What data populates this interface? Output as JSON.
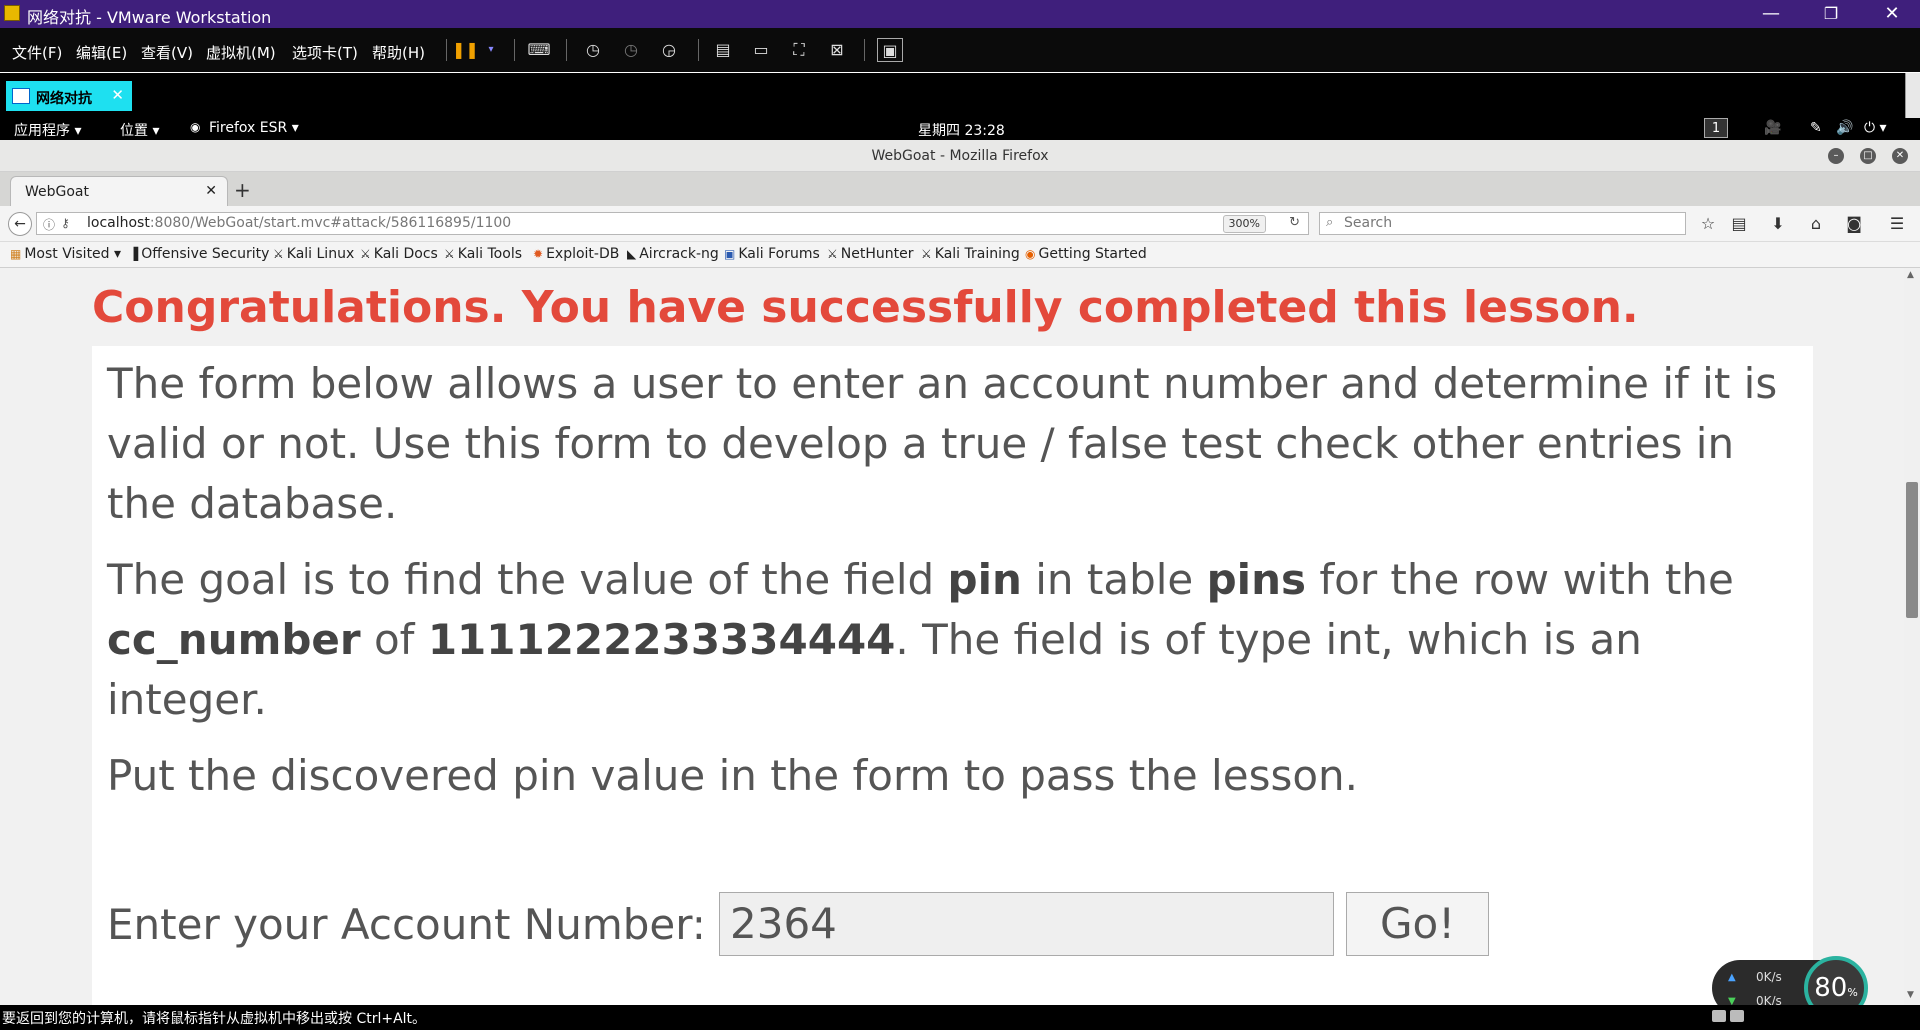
{
  "vmware": {
    "title": "网络对抗 - VMware Workstation",
    "window_controls": [
      "—",
      "❐",
      "✕"
    ],
    "menu": [
      "文件(F)",
      "编辑(E)",
      "查看(V)",
      "虚拟机(M)",
      "选项卡(T)",
      "帮助(H)"
    ],
    "toolbar_icons": [
      "pause-icon",
      "dropdown-icon",
      "send-keys-icon",
      "snapshot-take-icon",
      "snapshot-revert-icon",
      "snapshot-manager-icon",
      "view-sidebar-icon",
      "view-console-icon",
      "fullscreen-icon",
      "unity-icon",
      "thumbnail-view-icon"
    ],
    "tab_label": "网络对抗",
    "tab_close": "✕",
    "status_message": "要返回到您的计算机，请将鼠标指针从虚拟机中移出或按 Ctrl+Alt。"
  },
  "kali_panel": {
    "apps": "应用程序 ▾",
    "places": "位置 ▾",
    "browser": "Firefox ESR ▾",
    "clock": "星期四 23:28",
    "workspace": "1"
  },
  "firefox": {
    "window_title": "WebGoat - Mozilla Firefox",
    "tab_title": "WebGoat",
    "url_host": "localhost",
    "url_rest": ":8080/WebGoat/start.mvc#attack/586116895/1100",
    "zoom": "300%",
    "search_placeholder": "Search",
    "bookmarks": [
      {
        "label": "Most Visited",
        "icon": "folder-icon"
      },
      {
        "label": "Offensive Security",
        "icon": "offsec-icon"
      },
      {
        "label": "Kali Linux",
        "icon": "kali-icon"
      },
      {
        "label": "Kali Docs",
        "icon": "kali-icon"
      },
      {
        "label": "Kali Tools",
        "icon": "kali-icon"
      },
      {
        "label": "Exploit-DB",
        "icon": "exploit-db-icon"
      },
      {
        "label": "Aircrack-ng",
        "icon": "aircrack-icon"
      },
      {
        "label": "Kali Forums",
        "icon": "forums-icon"
      },
      {
        "label": "NetHunter",
        "icon": "kali-icon"
      },
      {
        "label": "Kali Training",
        "icon": "kali-icon"
      },
      {
        "label": "Getting Started",
        "icon": "firefox-icon"
      }
    ]
  },
  "lesson": {
    "congrats": "Congratulations. You have successfully completed this lesson.",
    "p1": "The form below allows a user to enter an account number and determine if it is valid or not. Use this form to develop a true / false test check other entries in the database.",
    "p2_a": "The goal is to find the value of the field ",
    "p2_field": "pin",
    "p2_b": " in table ",
    "p2_table": "pins",
    "p2_c": " for the row with the ",
    "p2_col": "cc_number",
    "p2_d": " of ",
    "p2_val": "1111222233334444",
    "p2_e": ". The field is of type int, which is an integer.",
    "p3": "Put the discovered pin value in the form to pass the lesson.",
    "account_label": "Enter your Account Number:",
    "account_value": "2364",
    "go_label": "Go!"
  },
  "net_widget": {
    "up_rate": "0K/s",
    "down_rate": "0K/s",
    "percent": "80",
    "percent_unit": "%"
  }
}
